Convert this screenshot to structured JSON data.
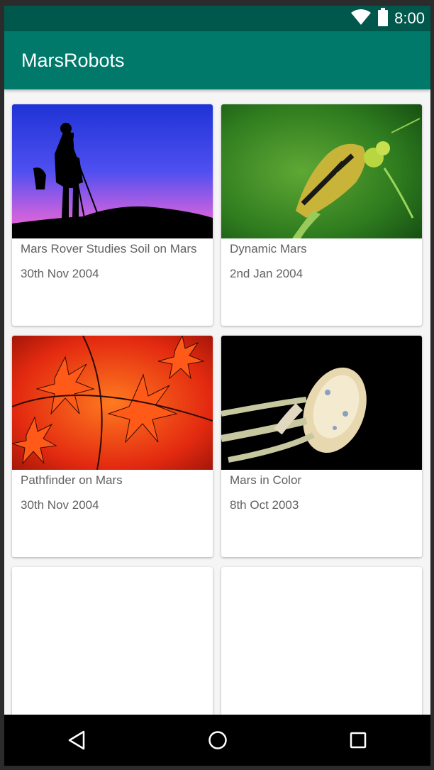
{
  "status_bar": {
    "time": "8:00",
    "icons": [
      "wifi-icon",
      "battery-icon"
    ],
    "background": "#00574b"
  },
  "app_bar": {
    "title": "MarsRobots",
    "background": "#00796b"
  },
  "cards": [
    {
      "title": "Mars Rover Studies Soil on Mars",
      "date": "30th Nov 2004",
      "image": "photographer-silhouette-image"
    },
    {
      "title": "Dynamic Mars",
      "date": "2nd Jan 2004",
      "image": "caterpillar-image"
    },
    {
      "title": "Pathfinder on Mars",
      "date": "30th Nov 2004",
      "image": "red-maple-leaves-image"
    },
    {
      "title": "Mars in Color",
      "date": "8th Oct 2003",
      "image": "jellyfish-image"
    },
    {
      "title": "",
      "date": "",
      "image": ""
    },
    {
      "title": "",
      "date": "",
      "image": ""
    }
  ],
  "nav_bar": {
    "buttons": [
      "back-icon",
      "home-icon",
      "recents-icon"
    ]
  }
}
